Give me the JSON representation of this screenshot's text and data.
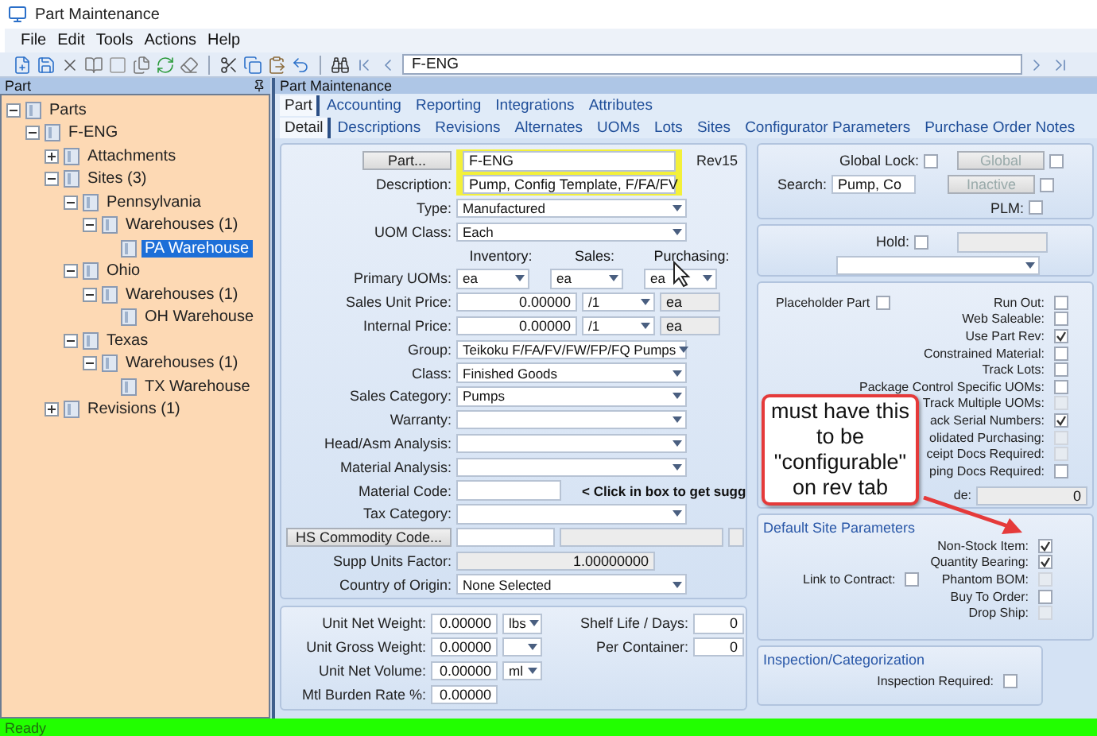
{
  "window": {
    "title": "Part Maintenance"
  },
  "menu": [
    "File",
    "Edit",
    "Tools",
    "Actions",
    "Help"
  ],
  "toolbar": {
    "part_field": "F-ENG"
  },
  "tree_panel": {
    "title": "Part",
    "tree": [
      {
        "label": "Parts",
        "expanded": true,
        "selected": false,
        "children": [
          {
            "label": "F-ENG",
            "expanded": true,
            "selected": false,
            "children": [
              {
                "label": "Attachments",
                "expanded": false,
                "selected": false
              },
              {
                "label": "Sites (3)",
                "expanded": true,
                "selected": false,
                "children": [
                  {
                    "label": "Pennsylvania",
                    "expanded": true,
                    "selected": false,
                    "children": [
                      {
                        "label": "Warehouses (1)",
                        "expanded": true,
                        "selected": false,
                        "children": [
                          {
                            "label": "PA Warehouse",
                            "selected": true
                          }
                        ]
                      }
                    ]
                  },
                  {
                    "label": "Ohio",
                    "expanded": true,
                    "selected": false,
                    "children": [
                      {
                        "label": "Warehouses (1)",
                        "expanded": true,
                        "selected": false,
                        "children": [
                          {
                            "label": "OH Warehouse",
                            "selected": false
                          }
                        ]
                      }
                    ]
                  },
                  {
                    "label": "Texas",
                    "expanded": true,
                    "selected": false,
                    "children": [
                      {
                        "label": "Warehouses (1)",
                        "expanded": true,
                        "selected": false,
                        "children": [
                          {
                            "label": "TX Warehouse",
                            "selected": false
                          }
                        ]
                      }
                    ]
                  }
                ]
              },
              {
                "label": "Revisions (1)",
                "expanded": false,
                "selected": false
              }
            ]
          }
        ]
      }
    ]
  },
  "main_panel": {
    "title": "Part Maintenance",
    "tabs": [
      {
        "label": "Part",
        "selected": true
      },
      {
        "label": "Accounting",
        "selected": false
      },
      {
        "label": "Reporting",
        "selected": false
      },
      {
        "label": "Integrations",
        "selected": false
      },
      {
        "label": "Attributes",
        "selected": false
      }
    ],
    "subtabs": [
      {
        "label": "Detail",
        "selected": true
      },
      {
        "label": "Descriptions",
        "selected": false
      },
      {
        "label": "Revisions",
        "selected": false
      },
      {
        "label": "Alternates",
        "selected": false
      },
      {
        "label": "UOMs",
        "selected": false
      },
      {
        "label": "Lots",
        "selected": false
      },
      {
        "label": "Sites",
        "selected": false
      },
      {
        "label": "Configurator Parameters",
        "selected": false
      },
      {
        "label": "Purchase Order Notes",
        "selected": false
      }
    ]
  },
  "form": [
    {
      "kind": "part",
      "button": "Part...",
      "value": "F-ENG",
      "rev": "Rev15",
      "highlighted": true
    },
    {
      "kind": "text",
      "label": "Description:",
      "value": "Pump, Config Template, F/FA/FV",
      "highlighted": true
    },
    {
      "kind": "dropdown",
      "label": "Type:",
      "value": "Manufactured"
    },
    {
      "kind": "dropdown",
      "label": "UOM Class:",
      "value": "Each"
    },
    {
      "kind": "headers",
      "columns": [
        "Inventory:",
        "Sales:",
        "Purchasing:"
      ]
    },
    {
      "kind": "uoms",
      "label": "Primary UOMs:",
      "values": [
        "ea",
        "ea",
        "ea"
      ]
    },
    {
      "kind": "price",
      "label": "Sales Unit Price:",
      "value": "0.00000",
      "per": "/1",
      "unit": "ea"
    },
    {
      "kind": "price",
      "label": "Internal Price:",
      "value": "0.00000",
      "per": "/1",
      "unit": "ea"
    },
    {
      "kind": "dropdown",
      "label": "Group:",
      "value": "Teikoku F/FA/FV/FW/FP/FQ Pumps"
    },
    {
      "kind": "dropdown",
      "label": "Class:",
      "value": "Finished Goods"
    },
    {
      "kind": "dropdown",
      "label": "Sales Category:",
      "value": "Pumps"
    },
    {
      "kind": "dropdown",
      "label": "Warranty:"
    },
    {
      "kind": "dropdown",
      "label": "Head/Asm Analysis:"
    },
    {
      "kind": "dropdown",
      "label": "Material Analysis:"
    },
    {
      "kind": "code",
      "label": "Material Code:",
      "note": "< Click in box to get sugg"
    },
    {
      "kind": "dropdown",
      "label": "Tax Category:"
    },
    {
      "kind": "hs",
      "button": "HS Commodity Code..."
    },
    {
      "kind": "readonly",
      "label": "Supp Units Factor:",
      "value": "1.00000000"
    },
    {
      "kind": "dropdown",
      "label": "Country of Origin:",
      "value": "None Selected"
    }
  ],
  "weights": [
    {
      "kind": "with_unit",
      "label": "Unit Net Weight:",
      "value": "0.00000",
      "unit": "lbs"
    },
    {
      "kind": "with_unit",
      "label": "Unit Gross Weight:",
      "value": "0.00000"
    },
    {
      "kind": "with_unit",
      "label": "Unit Net Volume:",
      "value": "0.00000",
      "unit": "ml"
    },
    {
      "kind": "plain",
      "label": "Mtl Burden Rate %:",
      "value": "0.00000"
    }
  ],
  "shelf": [
    {
      "label": "Shelf Life / Days:",
      "value": "0"
    },
    {
      "label": "Per Container:",
      "value": "0"
    }
  ],
  "global_panel": {
    "lock": {
      "label": "Global Lock:",
      "checked": false
    },
    "global_button": {
      "label": "Global",
      "disabled": true,
      "checked": false
    },
    "search": {
      "label": "Search:",
      "value": "Pump, Co"
    },
    "inactive_button": {
      "label": "Inactive",
      "disabled": true,
      "checked": false
    },
    "plm": {
      "label": "PLM:",
      "checked": false
    }
  },
  "hold_panel": {
    "label": "Hold:",
    "checked": false
  },
  "options_panel": {
    "placeholder": {
      "label": "Placeholder Part",
      "checked": false
    },
    "checks": [
      {
        "label": "Run Out:",
        "checked": false,
        "disabled": false
      },
      {
        "label": "Web Saleable:",
        "checked": false,
        "disabled": false
      },
      {
        "label": "Use Part Rev:",
        "checked": true,
        "disabled": false
      },
      {
        "label": "Constrained Material:",
        "checked": false,
        "disabled": false
      },
      {
        "label": "Track Lots:",
        "checked": false,
        "disabled": false
      },
      {
        "label": "Package Control Specific UOMs:",
        "checked": false,
        "disabled": false
      },
      {
        "label": "Track Multiple UOMs:",
        "checked": false,
        "disabled": true
      },
      {
        "label": "ack Serial Numbers:",
        "checked": true,
        "disabled": false
      },
      {
        "label": "olidated Purchasing:",
        "checked": false,
        "disabled": true
      },
      {
        "label": "ceipt Docs Required:",
        "checked": false,
        "disabled": true
      },
      {
        "label": "ping Docs Required:",
        "checked": false,
        "disabled": false
      }
    ],
    "field": {
      "label": "de:",
      "value": "0"
    }
  },
  "default_site": {
    "title": "Default Site Parameters",
    "link": {
      "label": "Link to Contract:",
      "checked": false
    },
    "checks": [
      {
        "label": "Non-Stock Item:",
        "checked": true,
        "disabled": false
      },
      {
        "label": "Quantity Bearing:",
        "checked": true,
        "disabled": false
      },
      {
        "label": "Phantom BOM:",
        "checked": false,
        "disabled": true
      },
      {
        "label": "Buy To Order:",
        "checked": false,
        "disabled": false
      },
      {
        "label": "Drop Ship:",
        "checked": false,
        "disabled": true
      }
    ]
  },
  "inspection": {
    "title": "Inspection/Categorization",
    "check": {
      "label": "Inspection Required:",
      "checked": false
    }
  },
  "callout": {
    "text": "must have this to be \"configurable\" on rev tab"
  },
  "status_bar": "Ready"
}
